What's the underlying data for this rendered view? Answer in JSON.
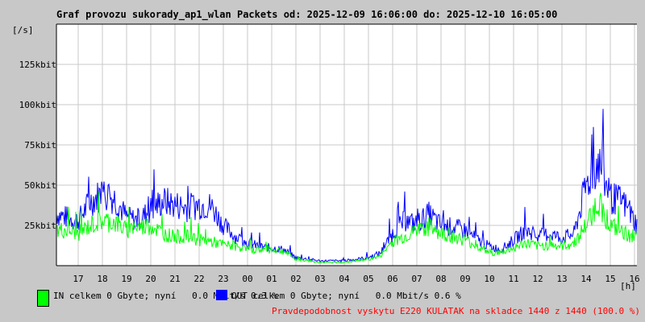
{
  "chart_data": {
    "type": "line",
    "title": "Graf provozu sukorady_ap1_wlan Packets od: 2025-12-09 16:06:00 do: 2025-12-10 16:05:00",
    "ylabel": "[/s]",
    "xlabel": "[h]",
    "ylim": [
      0,
      150
    ],
    "yticks": [
      25,
      50,
      75,
      100,
      125
    ],
    "ytick_labels": [
      "25kbit",
      "50kbit",
      "75kbit",
      "100kbit",
      "125kbit"
    ],
    "xtick_labels": [
      "17",
      "18",
      "19",
      "20",
      "21",
      "22",
      "23",
      "00",
      "01",
      "02",
      "03",
      "04",
      "05",
      "06",
      "07",
      "08",
      "09",
      "10",
      "11",
      "12",
      "13",
      "14",
      "15",
      "16"
    ],
    "x_unit": "hours since 16:00 (half-hour steps)",
    "grid": true,
    "series": [
      {
        "name": "IN",
        "color": "#00ff00",
        "values": [
          22,
          22,
          20,
          25,
          28,
          27,
          22,
          24,
          25,
          20,
          18,
          18,
          16,
          15,
          13,
          12,
          10,
          10,
          10,
          9,
          4,
          3,
          2,
          2,
          2,
          3,
          4,
          6,
          15,
          18,
          22,
          24,
          20,
          18,
          16,
          12,
          8,
          8,
          11,
          14,
          12,
          13,
          12,
          14,
          25,
          40,
          25,
          20,
          18
        ]
      },
      {
        "name": "OUT",
        "color": "#0000ff",
        "values": [
          33,
          30,
          28,
          40,
          45,
          42,
          30,
          28,
          35,
          40,
          38,
          36,
          38,
          37,
          25,
          18,
          14,
          12,
          11,
          10,
          5,
          4,
          3,
          3,
          3,
          4,
          5,
          8,
          20,
          28,
          26,
          32,
          25,
          24,
          22,
          16,
          12,
          10,
          16,
          22,
          18,
          20,
          17,
          20,
          50,
          65,
          42,
          40,
          28
        ]
      }
    ]
  },
  "legend": {
    "in_text": "IN celkem 0 Gbyte; nyní   0.0 Mbit/s 0.3 %",
    "out_text": "OUT celkem 0 Gbyte; nyní   0.0 Mbit/s 0.6 %",
    "in_color": "#00ff00",
    "out_color": "#0000ff"
  },
  "footer": {
    "text": "Pravdepodobnost vyskytu E220 KULATAK na skladce 1440 z 1440 (100.0 %)",
    "color": "#ff0000"
  }
}
